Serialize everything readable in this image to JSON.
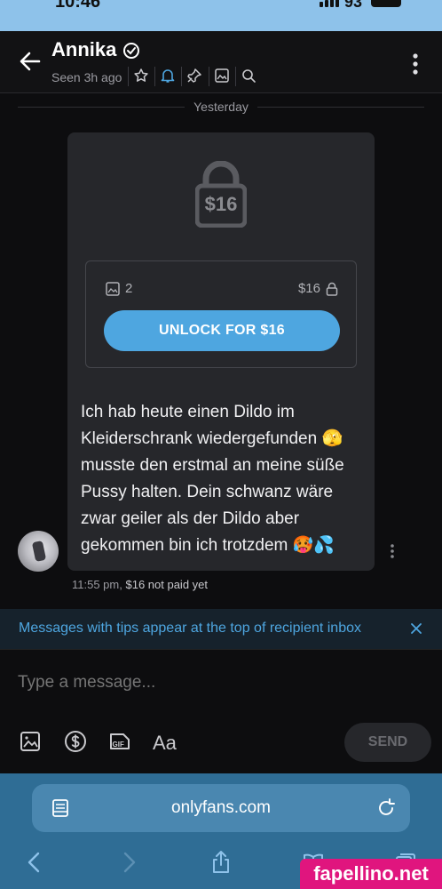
{
  "status_bar": {
    "time": "10:46",
    "battery": "93"
  },
  "header": {
    "name": "Annika",
    "seen": "Seen 3h ago"
  },
  "divider": {
    "label": "Yesterday"
  },
  "message": {
    "lock_price": "$16",
    "media_count": "2",
    "media_price": "$16",
    "unlock_label": "UNLOCK FOR $16",
    "text": "Ich hab heute einen Dildo im Kleiderschrank wiedergefunden 🫣 musste den erstmal an meine süße Pussy halten. Dein schwanz wäre zwar geiler als der Dildo aber gekommen bin ich trotzdem 🥵💦",
    "time": "11:55 pm,",
    "paid_status": "$16 not paid yet"
  },
  "tip_banner": {
    "text": "Messages with tips appear at the top of recipient inbox"
  },
  "composer": {
    "placeholder": "Type a message...",
    "format_label": "Aa",
    "send_label": "SEND"
  },
  "browser": {
    "url": "onlyfans.com"
  },
  "watermark": {
    "text": "fapellino.net"
  },
  "colors": {
    "accent": "#4ea6e0",
    "bubble": "#26272b",
    "background": "#0d0d0f",
    "browser": "#2f6d95",
    "watermark": "#e0157e"
  }
}
